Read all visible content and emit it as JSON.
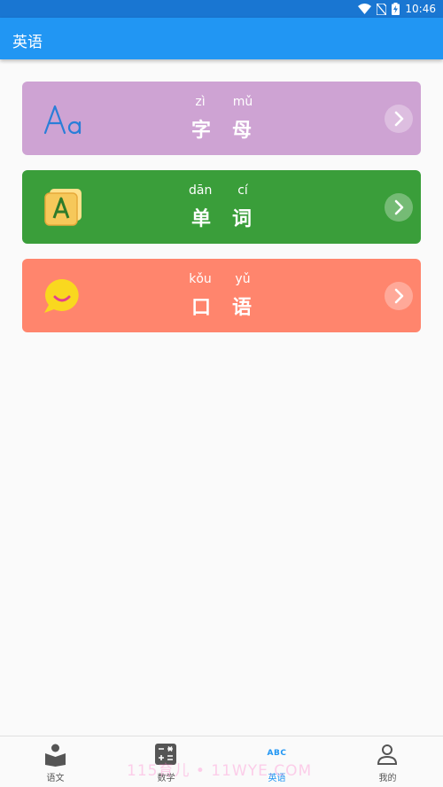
{
  "status_bar": {
    "time": "10:46",
    "icons": [
      "wifi-icon",
      "no-sim-icon",
      "battery-charging-icon"
    ]
  },
  "app_bar": {
    "title": "英语"
  },
  "cards": [
    {
      "pinyin": [
        "zì",
        "mǔ"
      ],
      "hanzi": [
        "字",
        "母"
      ],
      "icon": "font-aa-icon",
      "color": "#cea3d3"
    },
    {
      "pinyin": [
        "dān",
        "cí"
      ],
      "hanzi": [
        "单",
        "词"
      ],
      "icon": "letter-a-cards-icon",
      "color": "#3a9e3a"
    },
    {
      "pinyin": [
        "kǒu",
        "yǔ"
      ],
      "hanzi": [
        "口",
        "语"
      ],
      "icon": "speech-bubble-smile-icon",
      "color": "#ff856d"
    }
  ],
  "bottom_nav": [
    {
      "label": "语文",
      "icon": "book-reader-icon"
    },
    {
      "label": "数学",
      "icon": "calculator-icon"
    },
    {
      "label": "英语",
      "icon": "abc-icon",
      "icon_text": "ABC",
      "active": true
    },
    {
      "label": "我的",
      "icon": "person-icon"
    }
  ],
  "watermark": "115育儿 • 11WYE.COM",
  "colors": {
    "primary": "#2196f3",
    "status_bar": "#1976d2"
  }
}
